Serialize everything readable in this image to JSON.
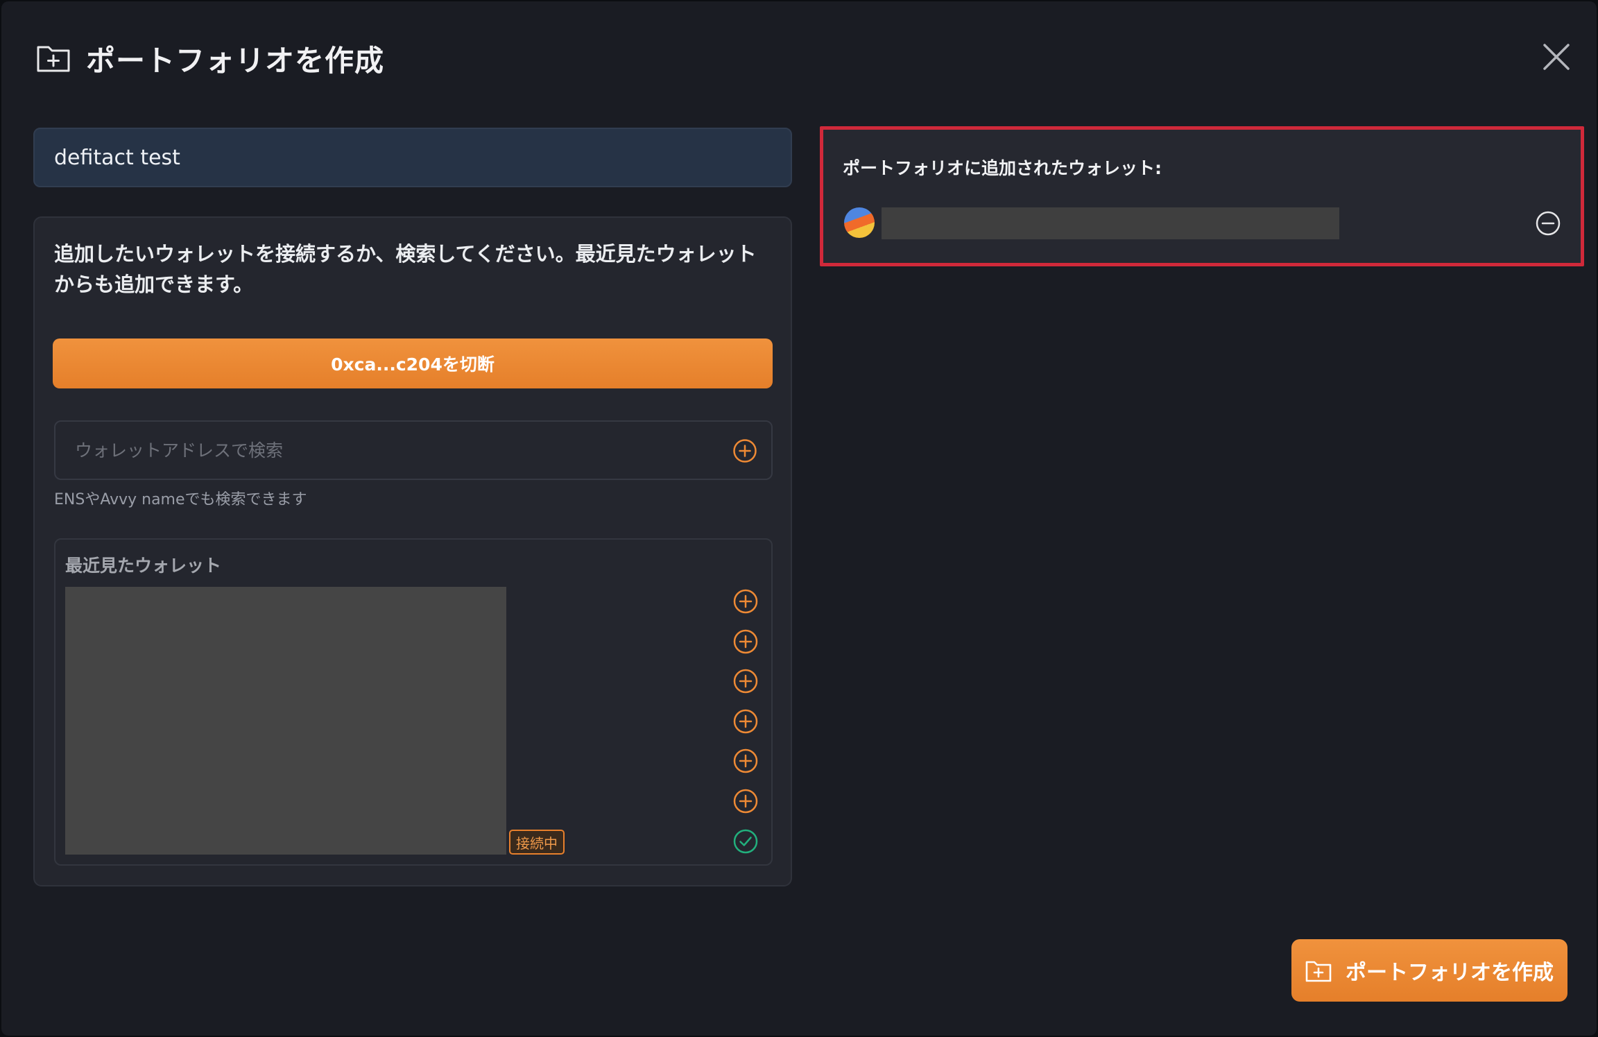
{
  "modal": {
    "title": "ポートフォリオを作成",
    "title_icon": "folder-plus-icon",
    "close_icon": "close-icon"
  },
  "portfolio_name": {
    "value": "defitact test"
  },
  "left_panel": {
    "instructions": "追加したいウォレットを接続するか、検索してください。最近見たウォレットからも追加できます。",
    "disconnect_button_label": "0xca...c204を切断",
    "search": {
      "placeholder": "ウォレットアドレスで検索",
      "value": "",
      "add_icon": "plus-circle-icon"
    },
    "search_hint": "ENSやAvvy nameでも検索できます",
    "recent": {
      "title": "最近見たウォレット",
      "connected_badge": "接続中",
      "rows": [
        {
          "action_icon": "plus-circle-icon",
          "state": "add"
        },
        {
          "action_icon": "plus-circle-icon",
          "state": "add"
        },
        {
          "action_icon": "plus-circle-icon",
          "state": "add"
        },
        {
          "action_icon": "plus-circle-icon",
          "state": "add"
        },
        {
          "action_icon": "plus-circle-icon",
          "state": "add"
        },
        {
          "action_icon": "plus-circle-icon",
          "state": "add"
        },
        {
          "action_icon": "check-circle-icon",
          "state": "added"
        }
      ]
    }
  },
  "right_panel": {
    "title": "ポートフォリオに追加されたウォレット:",
    "wallets": [
      {
        "remove_icon": "minus-circle-icon"
      }
    ]
  },
  "footer": {
    "create_button_label": "ポートフォリオを作成",
    "create_button_icon": "folder-plus-icon"
  },
  "colors": {
    "background": "#1a1c23",
    "accent_orange": "#ee8a35",
    "success_green": "#22b07d",
    "highlight_red": "#d0293a"
  }
}
